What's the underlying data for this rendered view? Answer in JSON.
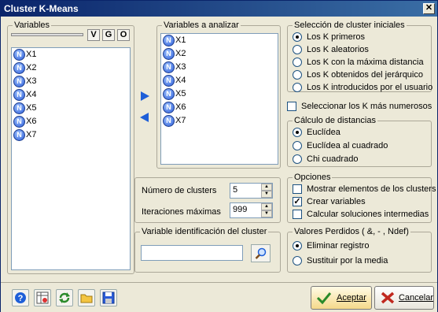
{
  "window": {
    "title": "Cluster K-Means",
    "close_label": "✕"
  },
  "variables": {
    "title": "Variables",
    "filter_buttons": [
      "V",
      "G",
      "O"
    ],
    "items": [
      {
        "icon": "N",
        "label": "X1"
      },
      {
        "icon": "N",
        "label": "X2"
      },
      {
        "icon": "N",
        "label": "X3"
      },
      {
        "icon": "N",
        "label": "X4"
      },
      {
        "icon": "N",
        "label": "X5"
      },
      {
        "icon": "N",
        "label": "X6"
      },
      {
        "icon": "N",
        "label": "X7"
      }
    ]
  },
  "analyze": {
    "title": "Variables a analizar",
    "items": [
      {
        "icon": "N",
        "label": "X1"
      },
      {
        "icon": "N",
        "label": "X2"
      },
      {
        "icon": "N",
        "label": "X3"
      },
      {
        "icon": "N",
        "label": "X4"
      },
      {
        "icon": "N",
        "label": "X5"
      },
      {
        "icon": "N",
        "label": "X6"
      },
      {
        "icon": "N",
        "label": "X7"
      }
    ]
  },
  "params": {
    "num_clusters_label": "Número de clusters",
    "num_clusters_value": "5",
    "iterations_label": "Iteraciones máximas",
    "iterations_value": "999"
  },
  "id_var": {
    "title": "Variable identificación del cluster",
    "value": ""
  },
  "initial": {
    "title": "Selección de cluster iniciales",
    "options": [
      "Los K primeros",
      "Los K aleatorios",
      "Los K con la máxima distancia",
      "Los K obtenidos del jerárquico",
      "Los K introducidos por el usuario"
    ],
    "selected": 0
  },
  "select_most": {
    "label": "Seleccionar los K más numerosos",
    "checked": false
  },
  "distance": {
    "title": "Cálculo de distancias",
    "options": [
      "Euclídea",
      "Euclídea al cuadrado",
      "Chi cuadrado"
    ],
    "selected": 0
  },
  "options": {
    "title": "Opciones",
    "items": [
      {
        "label": "Mostrar elementos de los clusters",
        "checked": false
      },
      {
        "label": "Crear variables",
        "checked": true
      },
      {
        "label": "Calcular soluciones intermedias",
        "checked": false
      }
    ]
  },
  "missing": {
    "title": "Valores Perdidos ( &, - , Ndef)",
    "options": [
      "Eliminar registro",
      "Sustituir por la media"
    ],
    "selected": 0
  },
  "buttons": {
    "accept": "Aceptar",
    "cancel": "Cancelar"
  },
  "colors": {
    "title_start": "#0a246a",
    "title_end": "#3a6ea5",
    "accent_blue": "#1e5fd8"
  }
}
